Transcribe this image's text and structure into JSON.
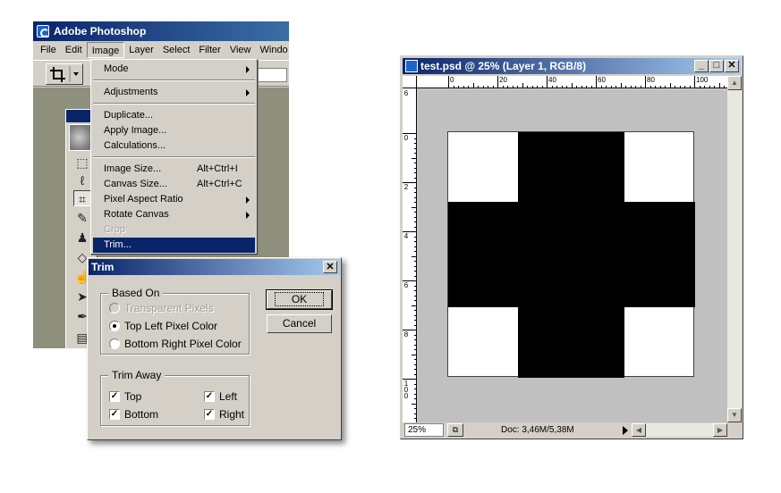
{
  "app": {
    "title": "Adobe Photoshop"
  },
  "menubar": [
    "File",
    "Edit",
    "Image",
    "Layer",
    "Select",
    "Filter",
    "View",
    "Windo"
  ],
  "image_menu": {
    "items": [
      {
        "label": "Mode",
        "submenu": true
      },
      {
        "label": "Adjustments",
        "submenu": true
      },
      {
        "label": "Duplicate..."
      },
      {
        "label": "Apply Image..."
      },
      {
        "label": "Calculations..."
      },
      {
        "label": "Image Size...",
        "shortcut": "Alt+Ctrl+I"
      },
      {
        "label": "Canvas Size...",
        "shortcut": "Alt+Ctrl+C"
      },
      {
        "label": "Pixel Aspect Ratio",
        "submenu": true
      },
      {
        "label": "Rotate Canvas",
        "submenu": true
      },
      {
        "label": "Crop",
        "disabled": true
      },
      {
        "label": "Trim...",
        "highlighted": true
      }
    ]
  },
  "trim_dialog": {
    "title": "Trim",
    "close": "✕",
    "based_on": {
      "label": "Based On",
      "options": [
        {
          "label": "Transparent Pixels",
          "disabled": true,
          "selected": false
        },
        {
          "label": "Top Left Pixel Color",
          "disabled": false,
          "selected": true
        },
        {
          "label": "Bottom Right Pixel Color",
          "disabled": false,
          "selected": false
        }
      ]
    },
    "trim_away": {
      "label": "Trim Away",
      "top": "Top",
      "bottom": "Bottom",
      "left": "Left",
      "right": "Right",
      "checked": {
        "top": true,
        "bottom": true,
        "left": true,
        "right": true
      }
    },
    "ok_label": "OK",
    "cancel_label": "Cancel"
  },
  "document": {
    "title": "test.psd @ 25% (Layer 1, RGB/8)",
    "buttons": {
      "minimize": "_",
      "maximize": "□",
      "close": "✕"
    },
    "ruler_h_labels": [
      "0",
      "20",
      "40",
      "60",
      "80",
      "100"
    ],
    "ruler_v_labels": [
      "6",
      "0",
      "2",
      "4",
      "6",
      "8",
      "1 0 0"
    ],
    "zoom": "25%",
    "doc_size": "Doc: 3,46M/5,38M"
  },
  "colors": {
    "title_active": "#0a246a",
    "face": "#d4d0c8",
    "workspace": "#8f8f7e",
    "pasteboard": "#c0c0c0"
  }
}
